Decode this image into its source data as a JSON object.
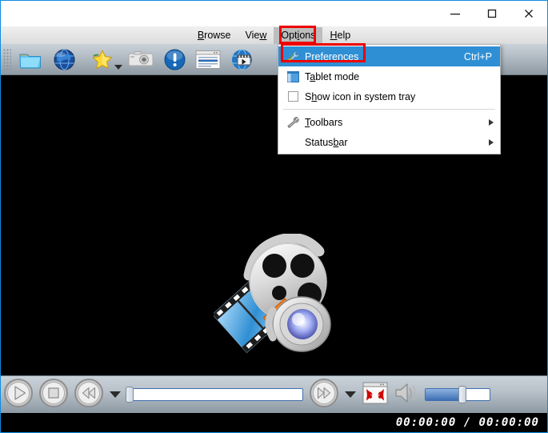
{
  "window": {
    "title": "",
    "controls": {
      "minimize_label": "Minimize",
      "maximize_label": "Maximize",
      "close_label": "Close"
    },
    "border_color": "#0f8ce0"
  },
  "menubar": {
    "items": [
      {
        "label": "Browse",
        "accel": "B",
        "open": false
      },
      {
        "label": "View",
        "accel": "w",
        "open": false
      },
      {
        "label": "Options",
        "accel": "i",
        "open": true
      },
      {
        "label": "Help",
        "accel": "H",
        "open": false
      }
    ]
  },
  "toolbar": {
    "buttons": [
      {
        "name": "open-folder-icon",
        "tooltip": "Open"
      },
      {
        "name": "open-url-globe-icon",
        "tooltip": "Open URL"
      },
      {
        "name": "favorites-star-icon",
        "tooltip": "Favorites",
        "has_caret": true
      },
      {
        "name": "screenshot-camera-icon",
        "tooltip": "Screenshot"
      },
      {
        "name": "information-icon",
        "tooltip": "Information"
      },
      {
        "name": "playlist-icon",
        "tooltip": "Playlist"
      },
      {
        "name": "video-globe-icon",
        "tooltip": "Video"
      }
    ]
  },
  "options_menu": {
    "items": [
      {
        "label": "Preferences",
        "accel": "r",
        "icon": "wrench-screwdriver-icon",
        "shortcut": "Ctrl+P",
        "selected": true,
        "submenu": false
      },
      {
        "label": "Tablet mode",
        "accel": "a",
        "icon": "tablet-window-icon",
        "shortcut": "",
        "selected": false,
        "submenu": false
      },
      {
        "label": "Show icon in system tray",
        "accel": "h",
        "icon": "checkbox-unchecked-icon",
        "shortcut": "",
        "selected": false,
        "submenu": false
      },
      {
        "label": "Toolbars",
        "accel": "T",
        "icon": "wrench-icon",
        "shortcut": "",
        "selected": false,
        "submenu": true
      },
      {
        "label": "Statusbar",
        "accel": "b",
        "icon": "",
        "shortcut": "",
        "selected": false,
        "submenu": true
      }
    ],
    "separator_after_index": 2,
    "highlight_color": "#2f8fd4"
  },
  "video": {
    "background": "#000000",
    "logo_name": "smplayer-film-reel-logo"
  },
  "controls": {
    "play_label": "Play",
    "stop_label": "Stop",
    "rewind_label": "Rewind",
    "forward_label": "Forward",
    "fullscreen_label": "Fullscreen",
    "mute_label": "Mute",
    "seek_value": 0,
    "volume_value": 55
  },
  "statusbar": {
    "time": "00:00:00 / 00:00:00",
    "current": "00:00:00",
    "total": "00:00:00"
  },
  "annotations": {
    "options_box_color": "#ee0000",
    "preferences_box_color": "#ee0000"
  }
}
